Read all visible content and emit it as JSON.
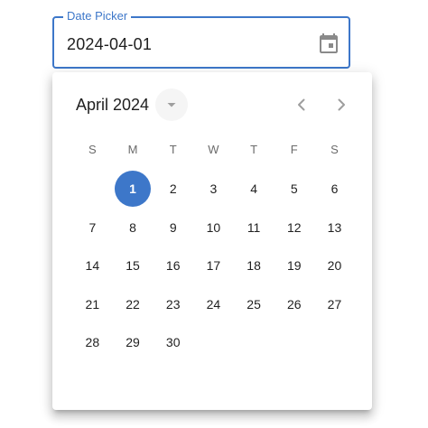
{
  "field": {
    "label": "Date Picker",
    "value": "2024-04-01",
    "icon": "calendar-icon"
  },
  "calendar": {
    "month_label": "April 2024",
    "weekdays": [
      "S",
      "M",
      "T",
      "W",
      "T",
      "F",
      "S"
    ],
    "first_weekday_offset": 1,
    "days": [
      "1",
      "2",
      "3",
      "4",
      "5",
      "6",
      "7",
      "8",
      "9",
      "10",
      "11",
      "12",
      "13",
      "14",
      "15",
      "16",
      "17",
      "18",
      "19",
      "20",
      "21",
      "22",
      "23",
      "24",
      "25",
      "26",
      "27",
      "28",
      "29",
      "30"
    ],
    "selected_day": "1",
    "icons": {
      "view_switch": "arrow-drop-down-icon",
      "prev": "chevron-left-icon",
      "next": "chevron-right-icon"
    }
  },
  "colors": {
    "accent": "#3d77c9",
    "text": "#1f1f1f",
    "muted": "#6b6b6b"
  }
}
